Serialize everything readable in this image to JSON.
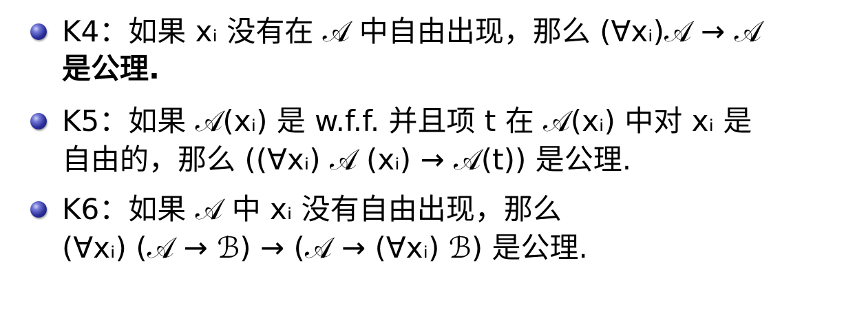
{
  "k4": {
    "line1": "K4：如果 xᵢ 没有在 𝒜 中自由出现，那么 (∀xᵢ)𝒜 → 𝒜",
    "line2": "是公理."
  },
  "k5": {
    "line1": "K5：如果 𝒜(xᵢ) 是 w.f.f. 并且项 t 在 𝒜(xᵢ) 中对 xᵢ 是",
    "line2": "自由的，那么 ((∀xᵢ) 𝒜 (xᵢ) → 𝒜(t)) 是公理."
  },
  "k6": {
    "line1": "K6：如果 𝒜 中 xᵢ 没有自由出现，那么",
    "line2": "(∀xᵢ) (𝒜 → ℬ) → (𝒜 → (∀xᵢ) ℬ) 是公理."
  }
}
